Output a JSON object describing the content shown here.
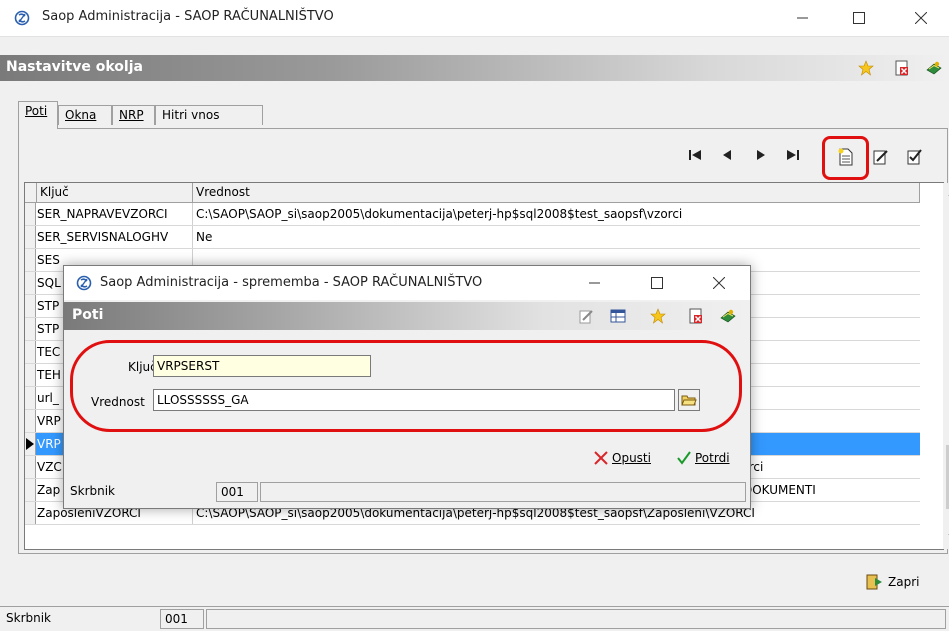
{
  "window": {
    "title": "Saop Administracija - SAOP RAČUNALNIŠTVO"
  },
  "header": {
    "title": "Nastavitve okolja"
  },
  "tabs": [
    {
      "label": "Poti",
      "active": true
    },
    {
      "label": "Okna",
      "active": false
    },
    {
      "label": "NRP",
      "active": false
    },
    {
      "label": "Hitri vnos",
      "active": false
    }
  ],
  "grid": {
    "columns": [
      "Ključ",
      "Vrednost"
    ],
    "rows": [
      {
        "key": "SER_NAPRAVEVZORCI",
        "value": "C:\\SAOP\\SAOP_si\\saop2005\\dokumentacija\\peterj-hp$sql2008$test_saopsf\\vzorci"
      },
      {
        "key": "SER_SERVISNALOGHV",
        "value": "Ne"
      },
      {
        "key": "SES",
        "value": ""
      },
      {
        "key": "SQL",
        "value": ""
      },
      {
        "key": "STP",
        "value": ""
      },
      {
        "key": "STP",
        "value": ""
      },
      {
        "key": "TEC",
        "value": ""
      },
      {
        "key": "TEH",
        "value": ""
      },
      {
        "key": "url_",
        "value": ""
      },
      {
        "key": "VRP",
        "value": ""
      },
      {
        "key": "VRP",
        "value": ""
      },
      {
        "key": "VZC",
        "value": "vzorci"
      },
      {
        "key": "Zap",
        "value": "ni\\DOKUMENTI"
      },
      {
        "key": "ZaposleniVZORCI",
        "value": "C:\\SAOP\\SAOP_si\\saop2005\\dokumentacija\\peterj-hp$sql2008$test_saopsf\\Zaposleni\\VZORCI"
      }
    ]
  },
  "actions": {
    "close_label": "Zapri"
  },
  "status": {
    "label": "Skrbnik",
    "value": "001"
  },
  "dialog": {
    "title": "Saop Administracija - sprememba - SAOP RAČUNALNIŠTVO",
    "header": "Poti",
    "key_label": "Ključ",
    "key_value": "VRPSERST",
    "value_label": "Vrednost",
    "value_value": "LLOSSSSSS_GA",
    "cancel_label": "Opusti",
    "confirm_label": "Potrdi",
    "status_label": "Skrbnik",
    "status_value": "001"
  },
  "colors": {
    "selection": "#3399ff",
    "highlight": "#e01010",
    "key_field_bg": "#ffffe1"
  }
}
